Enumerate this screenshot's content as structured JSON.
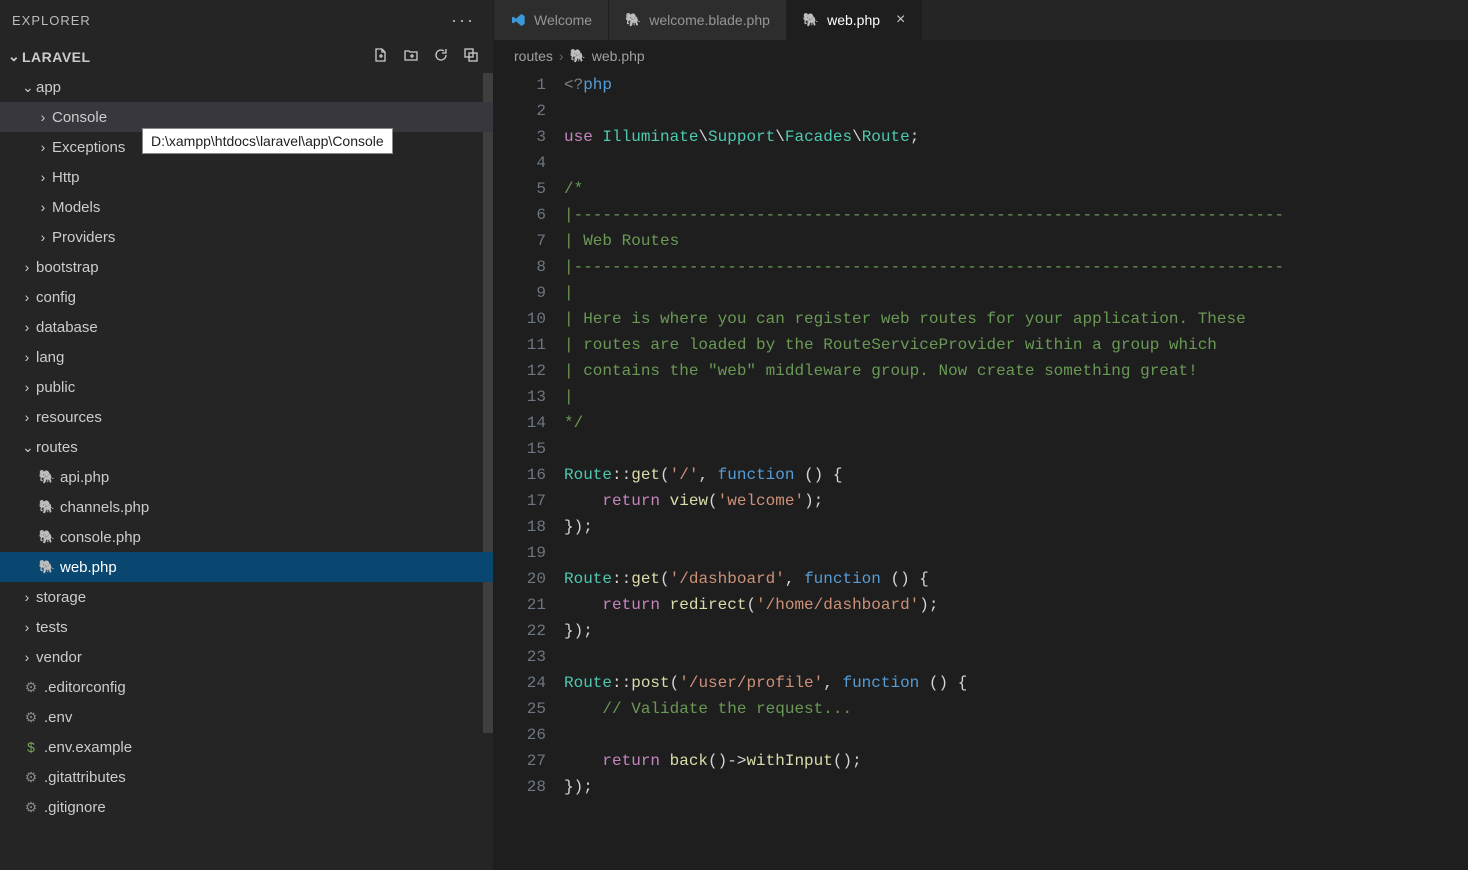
{
  "explorer": {
    "header": "EXPLORER",
    "project": "LARAVEL"
  },
  "tooltip": "D:\\xampp\\htdocs\\laravel\\app\\Console",
  "tree": [
    {
      "label": "app",
      "type": "folder",
      "expanded": true,
      "indent": 0
    },
    {
      "label": "Console",
      "type": "folder",
      "expanded": false,
      "indent": 1,
      "hovered": true
    },
    {
      "label": "Exceptions",
      "type": "folder",
      "expanded": false,
      "indent": 1
    },
    {
      "label": "Http",
      "type": "folder",
      "expanded": false,
      "indent": 1
    },
    {
      "label": "Models",
      "type": "folder",
      "expanded": false,
      "indent": 1
    },
    {
      "label": "Providers",
      "type": "folder",
      "expanded": false,
      "indent": 1
    },
    {
      "label": "bootstrap",
      "type": "folder",
      "expanded": false,
      "indent": 0
    },
    {
      "label": "config",
      "type": "folder",
      "expanded": false,
      "indent": 0
    },
    {
      "label": "database",
      "type": "folder",
      "expanded": false,
      "indent": 0
    },
    {
      "label": "lang",
      "type": "folder",
      "expanded": false,
      "indent": 0
    },
    {
      "label": "public",
      "type": "folder",
      "expanded": false,
      "indent": 0
    },
    {
      "label": "resources",
      "type": "folder",
      "expanded": false,
      "indent": 0
    },
    {
      "label": "routes",
      "type": "folder",
      "expanded": true,
      "indent": 0
    },
    {
      "label": "api.php",
      "type": "php",
      "indent": 1
    },
    {
      "label": "channels.php",
      "type": "php",
      "indent": 1
    },
    {
      "label": "console.php",
      "type": "php",
      "indent": 1
    },
    {
      "label": "web.php",
      "type": "php",
      "indent": 1,
      "selected": true
    },
    {
      "label": "storage",
      "type": "folder",
      "expanded": false,
      "indent": 0
    },
    {
      "label": "tests",
      "type": "folder",
      "expanded": false,
      "indent": 0
    },
    {
      "label": "vendor",
      "type": "folder",
      "expanded": false,
      "indent": 0
    },
    {
      "label": ".editorconfig",
      "type": "gear",
      "indent": 0
    },
    {
      "label": ".env",
      "type": "gear",
      "indent": 0
    },
    {
      "label": ".env.example",
      "type": "dollar",
      "indent": 0
    },
    {
      "label": ".gitattributes",
      "type": "gear",
      "indent": 0
    },
    {
      "label": ".gitignore",
      "type": "gear",
      "indent": 0
    }
  ],
  "tabs": [
    {
      "label": "Welcome",
      "icon": "vs",
      "active": false
    },
    {
      "label": "welcome.blade.php",
      "icon": "php",
      "active": false
    },
    {
      "label": "web.php",
      "icon": "php",
      "active": true,
      "close": true
    }
  ],
  "breadcrumbs": {
    "seg1": "routes",
    "seg2": "web.php"
  },
  "code": {
    "lines": [
      {
        "n": 1,
        "h": "<span class='tk-tag'>&lt;?</span><span class='tk-php'>php</span>"
      },
      {
        "n": 2,
        "h": ""
      },
      {
        "n": 3,
        "h": "<span class='tk-kw'>use</span> <span class='tk-cls'>Illuminate</span><span class='tk-white'>\\</span><span class='tk-cls'>Support</span><span class='tk-white'>\\</span><span class='tk-cls'>Facades</span><span class='tk-white'>\\</span><span class='tk-cls'>Route</span><span class='tk-pn'>;</span>"
      },
      {
        "n": 4,
        "h": ""
      },
      {
        "n": 5,
        "h": "<span class='tk-cm'>/*</span>"
      },
      {
        "n": 6,
        "h": "<span class='tk-cm'>|--------------------------------------------------------------------------</span>"
      },
      {
        "n": 7,
        "h": "<span class='tk-cm'>| Web Routes</span>"
      },
      {
        "n": 8,
        "h": "<span class='tk-cm'>|--------------------------------------------------------------------------</span>"
      },
      {
        "n": 9,
        "h": "<span class='tk-cm'>|</span>"
      },
      {
        "n": 10,
        "h": "<span class='tk-cm'>| Here is where you can register web routes for your application. These</span>"
      },
      {
        "n": 11,
        "h": "<span class='tk-cm'>| routes are loaded by the RouteServiceProvider within a group which</span>"
      },
      {
        "n": 12,
        "h": "<span class='tk-cm'>| contains the \"web\" middleware group. Now create something great!</span>"
      },
      {
        "n": 13,
        "h": "<span class='tk-cm'>|</span>"
      },
      {
        "n": 14,
        "h": "<span class='tk-cm'>*/</span>"
      },
      {
        "n": 15,
        "h": ""
      },
      {
        "n": 16,
        "h": "<span class='tk-cls'>Route</span><span class='tk-pn'>::</span><span class='tk-fn'>get</span><span class='tk-pn'>(</span><span class='tk-str'>'/'</span><span class='tk-pn'>, </span><span class='tk-php'>function</span> <span class='tk-pn'>() {</span>"
      },
      {
        "n": 17,
        "h": "    <span class='tk-kw'>return</span> <span class='tk-fn'>view</span><span class='tk-pn'>(</span><span class='tk-str'>'welcome'</span><span class='tk-pn'>);</span>"
      },
      {
        "n": 18,
        "h": "<span class='tk-pn'>});</span>"
      },
      {
        "n": 19,
        "h": ""
      },
      {
        "n": 20,
        "h": "<span class='tk-cls'>Route</span><span class='tk-pn'>::</span><span class='tk-fn'>get</span><span class='tk-pn'>(</span><span class='tk-str'>'/dashboard'</span><span class='tk-pn'>, </span><span class='tk-php'>function</span> <span class='tk-pn'>() {</span>"
      },
      {
        "n": 21,
        "h": "    <span class='tk-kw'>return</span> <span class='tk-fn'>redirect</span><span class='tk-pn'>(</span><span class='tk-str'>'/home/dashboard'</span><span class='tk-pn'>);</span>"
      },
      {
        "n": 22,
        "h": "<span class='tk-pn'>});</span>"
      },
      {
        "n": 23,
        "h": ""
      },
      {
        "n": 24,
        "h": "<span class='tk-cls'>Route</span><span class='tk-pn'>::</span><span class='tk-fn'>post</span><span class='tk-pn'>(</span><span class='tk-str'>'/user/profile'</span><span class='tk-pn'>, </span><span class='tk-php'>function</span> <span class='tk-pn'>() {</span>"
      },
      {
        "n": 25,
        "h": "    <span class='tk-cm'>// Validate the request...</span>"
      },
      {
        "n": 26,
        "h": ""
      },
      {
        "n": 27,
        "h": "    <span class='tk-kw'>return</span> <span class='tk-fn'>back</span><span class='tk-pn'>()-&gt;</span><span class='tk-fn'>withInput</span><span class='tk-pn'>();</span>"
      },
      {
        "n": 28,
        "h": "<span class='tk-pn'>});</span>"
      }
    ]
  }
}
